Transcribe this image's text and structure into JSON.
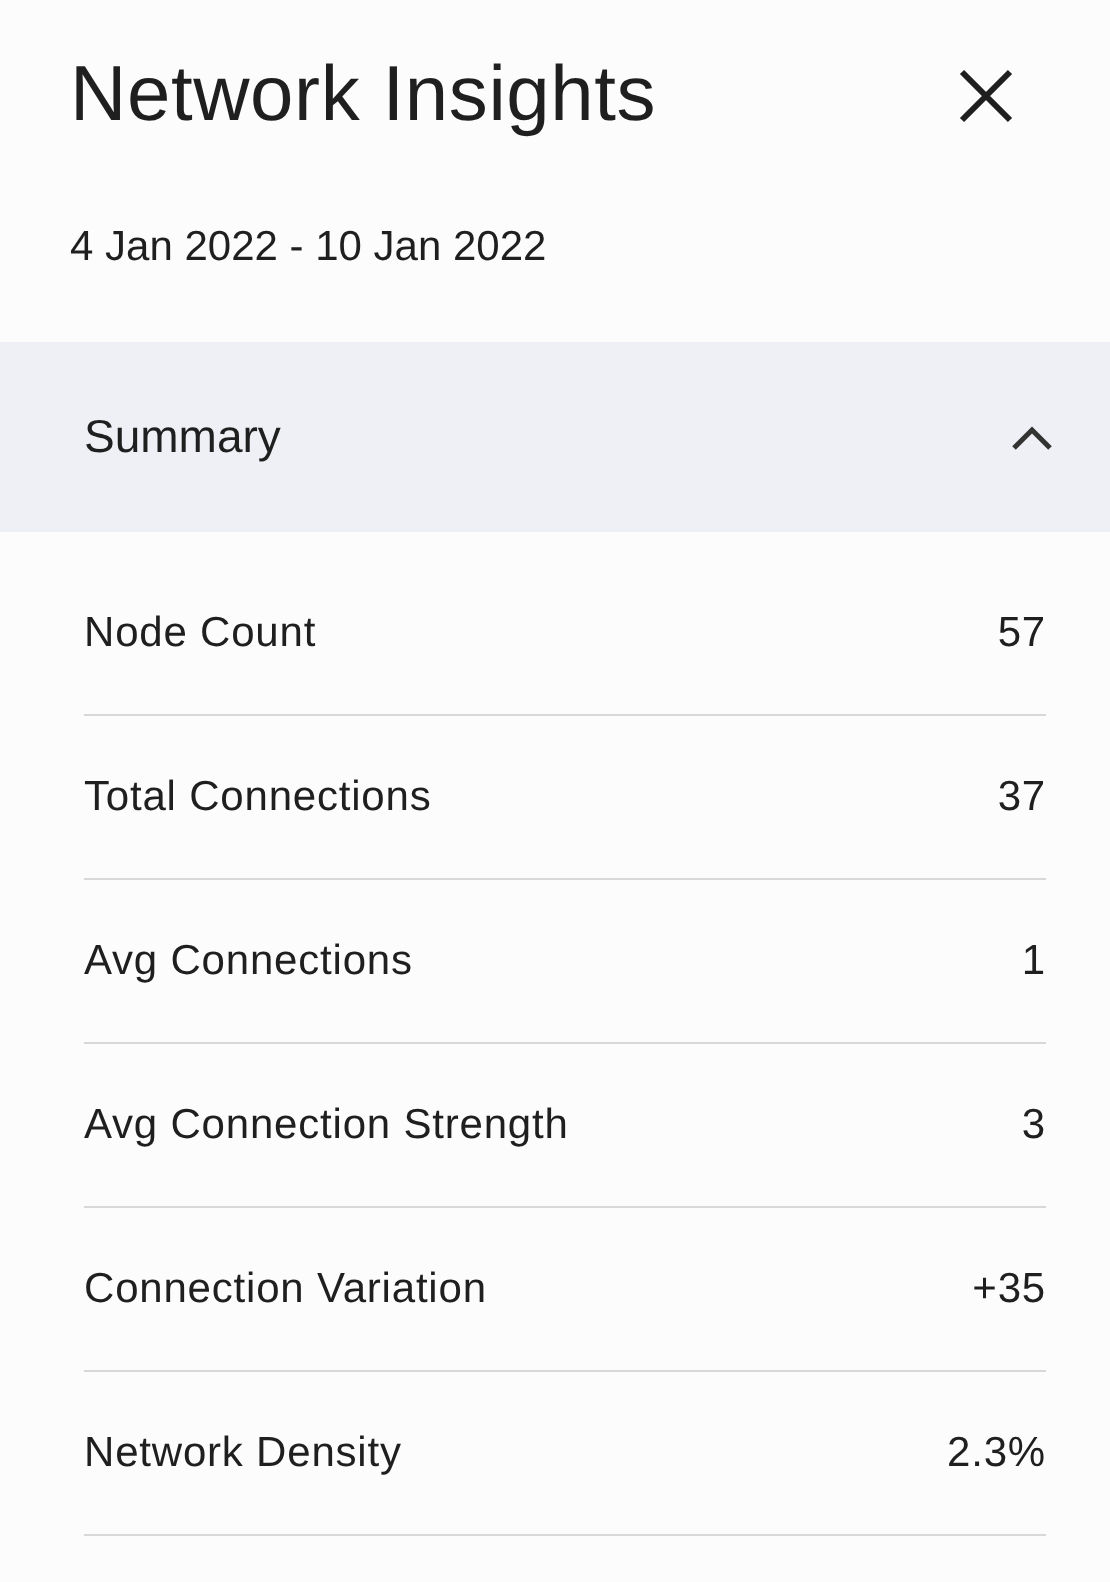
{
  "panel": {
    "title": "Network Insights",
    "date_range": "4 Jan 2022 - 10 Jan 2022"
  },
  "summary": {
    "title": "Summary",
    "expanded": true,
    "rows": [
      {
        "label": "Node Count",
        "value": "57"
      },
      {
        "label": "Total Connections",
        "value": "37"
      },
      {
        "label": "Avg Connections",
        "value": "1"
      },
      {
        "label": "Avg Connection Strength",
        "value": "3"
      },
      {
        "label": "Connection Variation",
        "value": "+35"
      },
      {
        "label": "Network Density",
        "value": "2.3%"
      }
    ]
  }
}
